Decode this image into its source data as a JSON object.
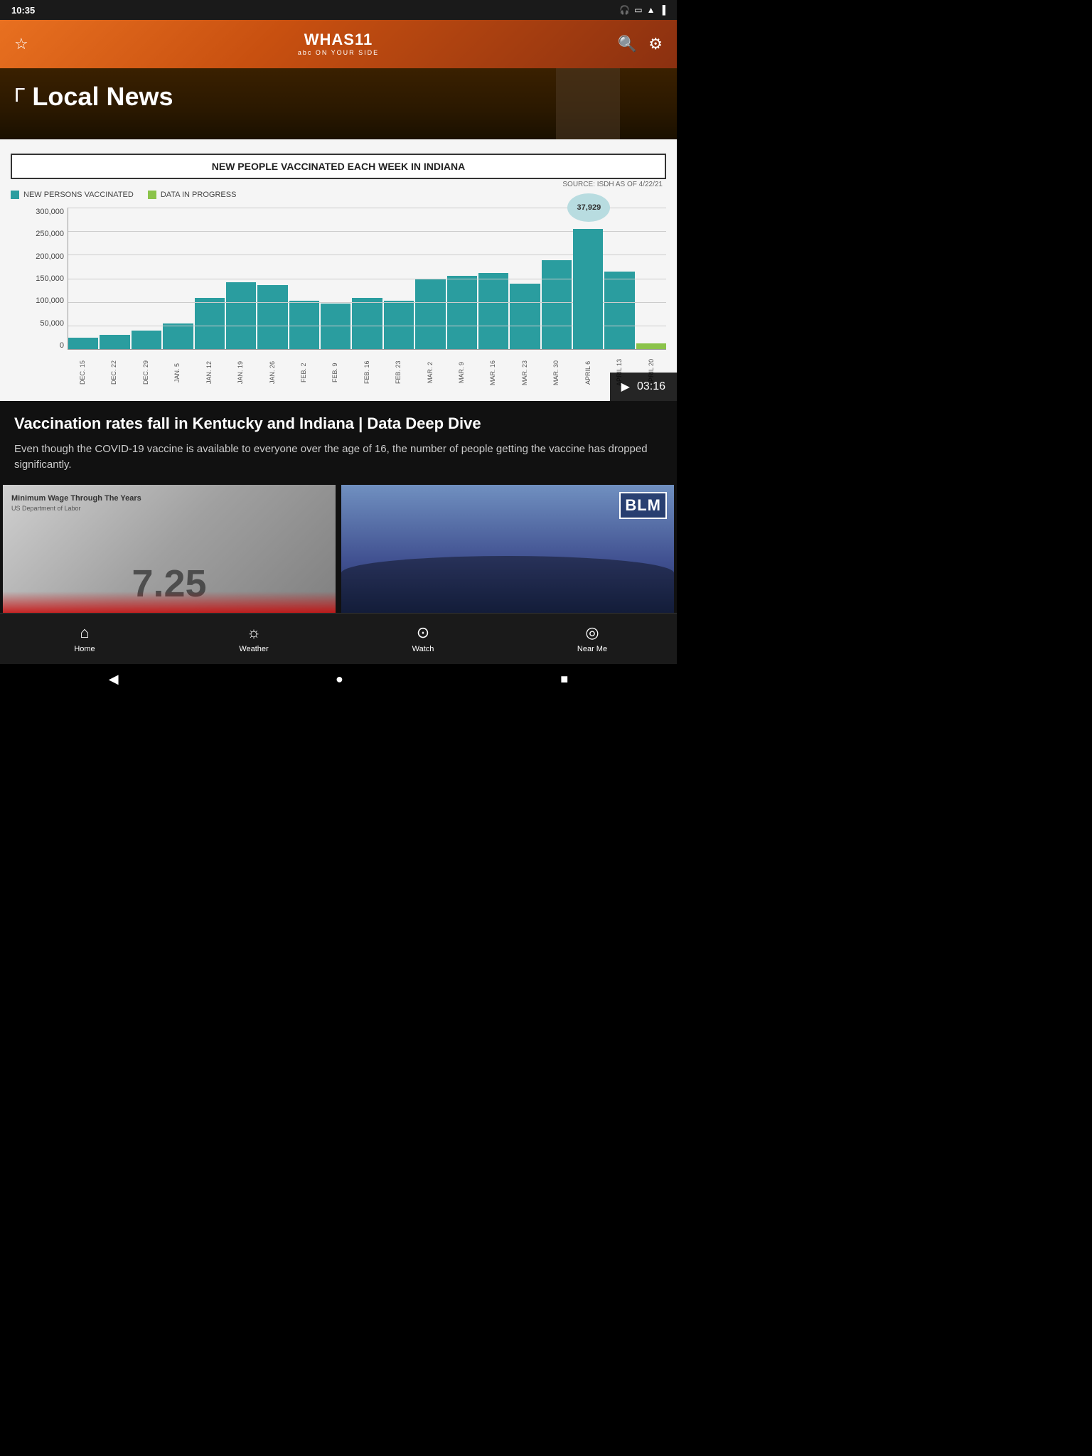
{
  "status_bar": {
    "time": "10:35",
    "icons": [
      "wifi",
      "battery",
      "signal"
    ]
  },
  "header": {
    "logo": "WHAS11",
    "logo_sub": "abc ON YOUR SIDE",
    "favorite_icon": "☆",
    "search_icon": "🔍",
    "settings_icon": "⚙"
  },
  "hero": {
    "section_title": "Local News",
    "bracket": "Γ"
  },
  "chart": {
    "title": "NEW PEOPLE VACCINATED EACH WEEK IN INDIANA",
    "source": "SOURCE: ISDH AS OF 4/22/21",
    "legend": [
      {
        "label": "NEW PERSONS VACCINATED",
        "color": "teal"
      },
      {
        "label": "DATA IN PROGRESS",
        "color": "green"
      }
    ],
    "y_labels": [
      "300,000",
      "250,000",
      "200,000",
      "150,000",
      "100,000",
      "50,000",
      "0"
    ],
    "x_labels": [
      "DEC. 15",
      "DEC. 22",
      "DEC. 29",
      "JAN. 5",
      "JAN. 12",
      "JAN. 19",
      "JAN. 26",
      "FEB. 2",
      "FEB. 9",
      "FEB. 16",
      "FEB. 23",
      "MAR. 2",
      "MAR. 9",
      "MAR. 16",
      "MAR. 23",
      "MAR. 30",
      "APRIL 6",
      "APRIL 13",
      "APRIL 20"
    ],
    "bars": [
      12,
      14,
      18,
      25,
      40,
      52,
      50,
      38,
      35,
      45,
      38,
      55,
      57,
      60,
      52,
      70,
      88,
      58,
      8
    ],
    "callout_value": "37,929",
    "callout_bar_index": 17,
    "duration": "03:16"
  },
  "article": {
    "headline": "Vaccination rates fall in Kentucky and Indiana | Data Deep Dive",
    "body": "Even though the COVID-19 vaccine is available to everyone over the age of 16, the number of people getting the vaccine has dropped significantly."
  },
  "cards": [
    {
      "title": "Minimum Wage Through The Years",
      "subtitle": "US Department of Labor",
      "number": "7.25"
    },
    {
      "label": "BLM"
    }
  ],
  "bottom_nav": {
    "items": [
      {
        "icon": "⌂",
        "label": "Home"
      },
      {
        "icon": "☼",
        "label": "Weather"
      },
      {
        "icon": "▶",
        "label": "Watch",
        "active": true
      },
      {
        "icon": "◎",
        "label": "Near Me"
      }
    ]
  },
  "android_nav": {
    "back": "◀",
    "home": "●",
    "recent": "■"
  }
}
